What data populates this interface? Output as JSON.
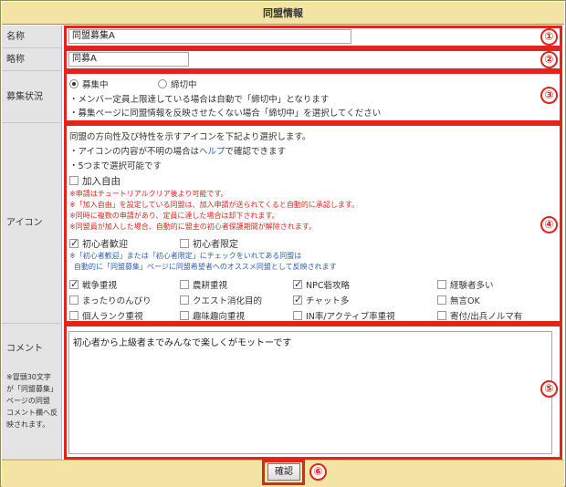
{
  "header": {
    "title": "同盟情報"
  },
  "name_row": {
    "label": "名称",
    "value": "同盟募集A"
  },
  "abbr_row": {
    "label": "略称",
    "value": "同募A"
  },
  "recruit_row": {
    "label": "募集状況",
    "option_open": "募集中",
    "option_closed": "締切中",
    "selected": "募集中",
    "note1": "・メンバー定員上限達している場合は自動で「締切中」となります",
    "note2": "・募集ページに同盟情報を反映させたくない場合「締切中」を選択してください"
  },
  "icon_row": {
    "label": "アイコン",
    "intro1": "同盟の方向性及び特性を示すアイコンを下記より選択します。",
    "intro2_pre": "・アイコンの内容が不明の場合は",
    "intro2_link": "ヘルプ",
    "intro2_post": "で確認できます",
    "intro3": "・5つまで選択可能です",
    "free_join_label": "加入自由",
    "free_join_notes": [
      "※申請はチュートリアルクリア後より可能です。",
      "※「加入自由」を設定している同盟は、加入申請が送られてくると自動的に承認します。",
      "※同時に複数の申請があり、定員に達した場合は却下されます。",
      "※同盟員が加入した場合、自動的に盟主の初心者保護期間が解除されます。"
    ],
    "beginner_welcome": "初心者歓迎",
    "beginner_only": "初心者限定",
    "beginner_notes": [
      "※「初心者歓迎」または「初心者限定」にチェックをいれてある同盟は",
      "自動的に「同盟募集」ページに同盟希望者へのオススメ同盟として反映されます"
    ],
    "options": [
      {
        "label": "戦争重視",
        "checked": true
      },
      {
        "label": "農耕重視",
        "checked": false
      },
      {
        "label": "NPC砦攻略",
        "checked": true
      },
      {
        "label": "経験者多い",
        "checked": false
      },
      {
        "label": "まったりのんびり",
        "checked": false
      },
      {
        "label": "クエスト消化目的",
        "checked": false
      },
      {
        "label": "チャット多",
        "checked": true
      },
      {
        "label": "無言OK",
        "checked": false
      },
      {
        "label": "個人ランク重視",
        "checked": false
      },
      {
        "label": "趣味趣向重視",
        "checked": false
      },
      {
        "label": "IN率/アクティブ率重視",
        "checked": false
      },
      {
        "label": "寄付/出兵ノルマ有",
        "checked": false
      }
    ]
  },
  "comment_row": {
    "label": "コメント",
    "hint": [
      "※冒頭30文字",
      "が「同盟募集」",
      "ページの同盟",
      "コメント欄へ反",
      "映されます。"
    ],
    "value": "初心者から上級者までみんなで楽しくがモットーです"
  },
  "footer": {
    "confirm_label": "確認"
  },
  "markers": [
    "①",
    "②",
    "③",
    "④",
    "⑤",
    "⑥"
  ],
  "colors": {
    "header_bg": "#f3e3a4",
    "label_bg": "#e4e4e4",
    "highlight": "#e3241b",
    "link": "#2a60b8"
  }
}
